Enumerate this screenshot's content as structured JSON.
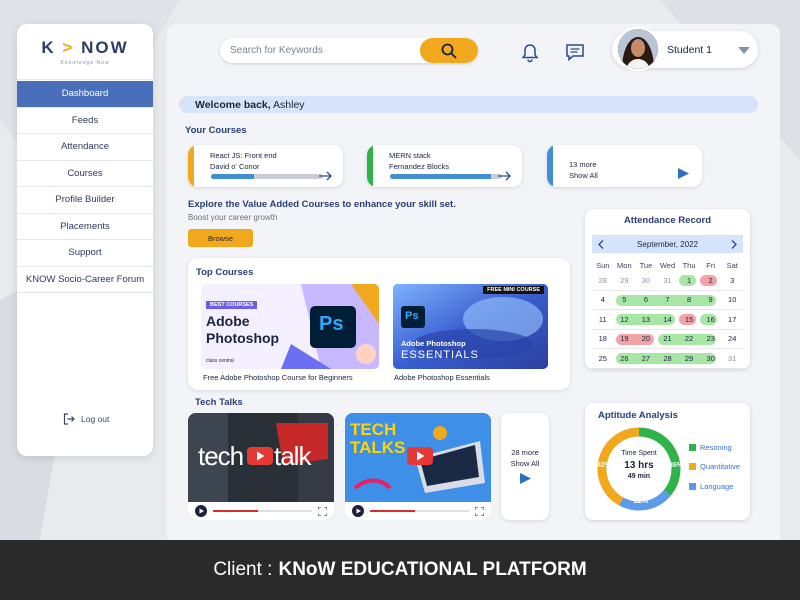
{
  "brand": {
    "logo_left": "K",
    "logo_arrow": ">",
    "logo_right": "NOW",
    "tagline": "Knowledge Now"
  },
  "sidebar": {
    "items": [
      {
        "label": "Dashboard",
        "active": true
      },
      {
        "label": "Feeds"
      },
      {
        "label": "Attendance"
      },
      {
        "label": "Courses"
      },
      {
        "label": "Profile Builder"
      },
      {
        "label": "Placements"
      },
      {
        "label": "Support"
      },
      {
        "label": "KNOW Socio-Career Forum"
      }
    ],
    "logout": "Log out"
  },
  "header": {
    "search_placeholder": "Search for Keywords",
    "user_name": "Student 1"
  },
  "welcome": {
    "prefix": "Welcome back,",
    "name": "Ashley"
  },
  "your_courses": {
    "title": "Your Courses",
    "items": [
      {
        "title": "React JS: Front end",
        "author": "David o' Conor",
        "progress": 0.38,
        "accent": "#f2a81d"
      },
      {
        "title": "MERN stack",
        "author": "Fernandez Blocks",
        "progress": 0.9,
        "accent": "#2fb24a"
      }
    ],
    "more": {
      "count": "13 more",
      "link": "Show All",
      "accent": "#3f8fd2"
    }
  },
  "explore": {
    "title": "Explore the Value Added Courses to enhance your skill set.",
    "subtitle": "Boost your career growth",
    "button": "Browse"
  },
  "top_courses": {
    "title": "Top Courses",
    "items": [
      {
        "badge": "BEST COURSES",
        "line1": "Adobe",
        "line2": "Photoshop",
        "ps": "Ps",
        "source": "class central",
        "caption": "Free Adobe Photoshop Course for Beginners"
      },
      {
        "badge": "FREE MINI COURSE",
        "line1": "Adobe Photoshop",
        "line2": "ESSENTIALS",
        "ps": "Ps",
        "caption": "Adobe Photoshop Essentials"
      }
    ]
  },
  "tech_talks": {
    "title": "Tech Talks",
    "videos": [
      {
        "text_left": "tech",
        "text_right": "talk"
      },
      {
        "line1": "TECH",
        "line2": "TALKS"
      }
    ],
    "more": {
      "count": "28 more",
      "link": "Show All"
    }
  },
  "attendance": {
    "title": "Attendance Record",
    "month": "September, 2022",
    "weekdays": [
      "Sun",
      "Mon",
      "Tue",
      "Wed",
      "Thu",
      "Fri",
      "Sat"
    ],
    "weeks": [
      [
        "28",
        "29",
        "30",
        "31",
        "1",
        "2",
        "3"
      ],
      [
        "4",
        "5",
        "6",
        "7",
        "8",
        "9",
        "10"
      ],
      [
        "11",
        "12",
        "13",
        "14",
        "15",
        "16",
        "17"
      ],
      [
        "18",
        "19",
        "20",
        "21",
        "22",
        "23",
        "24"
      ],
      [
        "25",
        "26",
        "27",
        "28",
        "29",
        "30",
        "31"
      ]
    ],
    "present_color": "#a8e6a6",
    "absent_color": "#f2a3a8"
  },
  "aptitude": {
    "title": "Aptitude Analysis",
    "center_label": "Time Spent",
    "center_value": "13 hrs",
    "center_sub": "49 min",
    "segments": [
      {
        "label": "Resoning",
        "percent": "36%",
        "value": 36,
        "color": "#2fb24a"
      },
      {
        "label": "Quantitative",
        "percent": "42%",
        "value": 42,
        "color": "#f2a81d"
      },
      {
        "label": "Language",
        "percent": "22%",
        "value": 22,
        "color": "#5b9bea"
      }
    ]
  },
  "footer": {
    "prefix": "Client :",
    "client": "KNoW EDUCATIONAL PLATFORM"
  }
}
